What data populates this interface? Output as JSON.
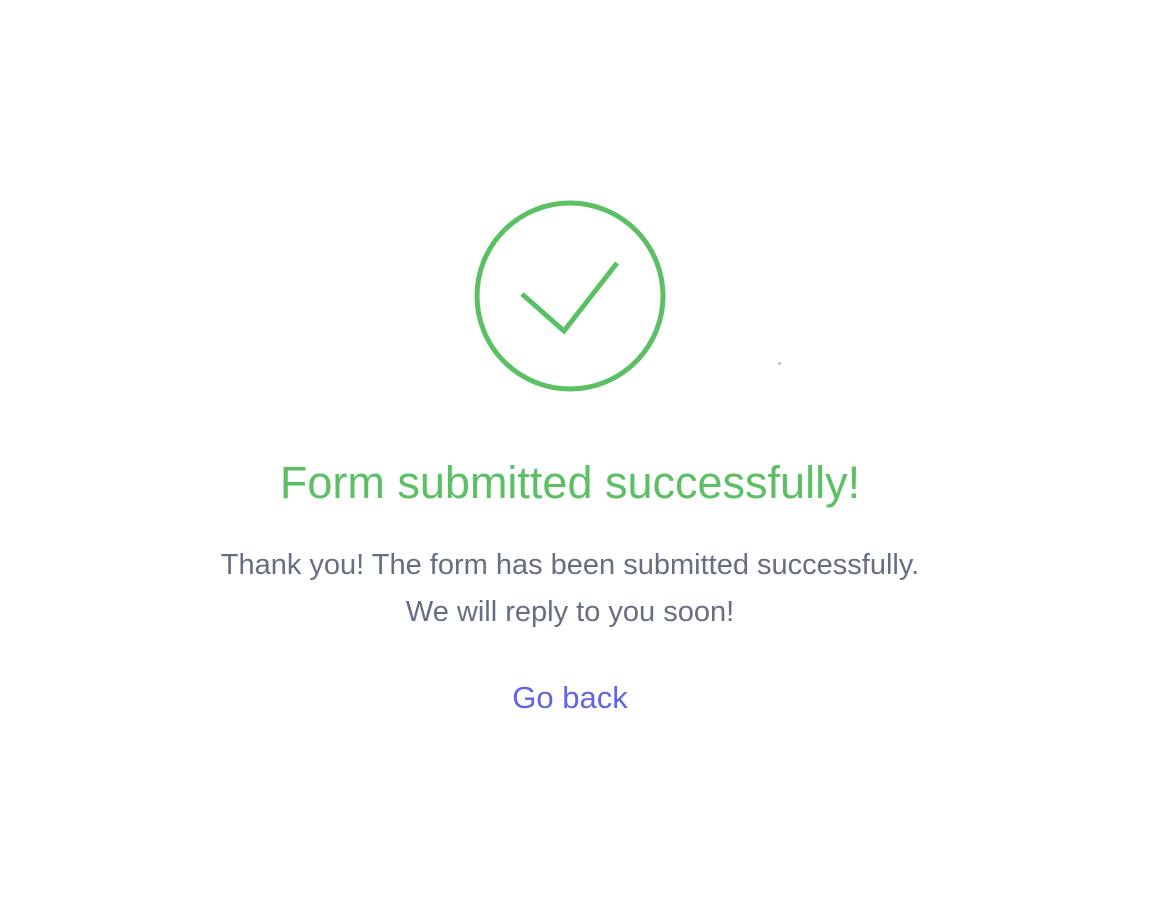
{
  "colors": {
    "success": "#5bbf64",
    "body_text": "#666f82",
    "link": "#6363e5",
    "background": "#ffffff"
  },
  "icon": {
    "name": "check-circle-icon"
  },
  "title": "Form submitted successfully!",
  "message": {
    "line1": "Thank you! The form has been submitted successfully.",
    "line2": "We will reply to you soon!"
  },
  "back_link": {
    "label": "Go back"
  }
}
